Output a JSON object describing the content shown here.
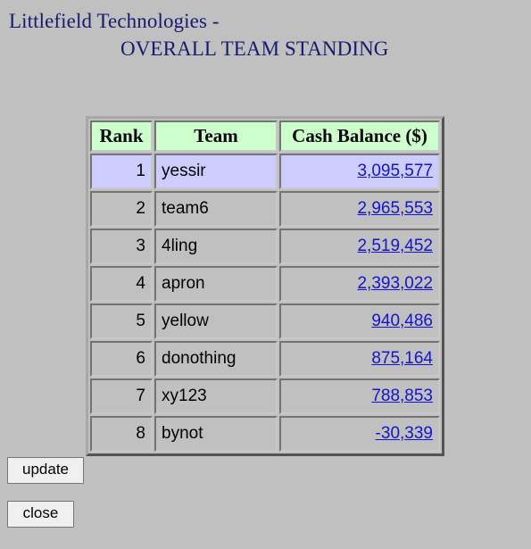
{
  "header": {
    "title_line1": "Littlefield Technologies -",
    "title_line2": "OVERALL TEAM STANDING",
    "title_color": "#191970"
  },
  "table": {
    "columns": [
      "Rank",
      "Team",
      "Cash Balance ($)"
    ],
    "header_background": "#ccffcc",
    "highlight_background": "#ccccff",
    "link_color": "#1414cd",
    "rows": [
      {
        "rank": "1",
        "team": "yessir",
        "cash": "3,095,577",
        "highlighted": true
      },
      {
        "rank": "2",
        "team": "team6",
        "cash": "2,965,553",
        "highlighted": false
      },
      {
        "rank": "3",
        "team": "4ling",
        "cash": "2,519,452",
        "highlighted": false
      },
      {
        "rank": "4",
        "team": "apron",
        "cash": "2,393,022",
        "highlighted": false
      },
      {
        "rank": "5",
        "team": "yellow",
        "cash": "940,486",
        "highlighted": false
      },
      {
        "rank": "6",
        "team": "donothing",
        "cash": "875,164",
        "highlighted": false
      },
      {
        "rank": "7",
        "team": "xy123",
        "cash": "788,853",
        "highlighted": false
      },
      {
        "rank": "8",
        "team": "bynot",
        "cash": "-30,339",
        "highlighted": false
      }
    ]
  },
  "buttons": {
    "update_label": "update",
    "close_label": "close"
  },
  "page": {
    "background": "#c0c0c0"
  }
}
